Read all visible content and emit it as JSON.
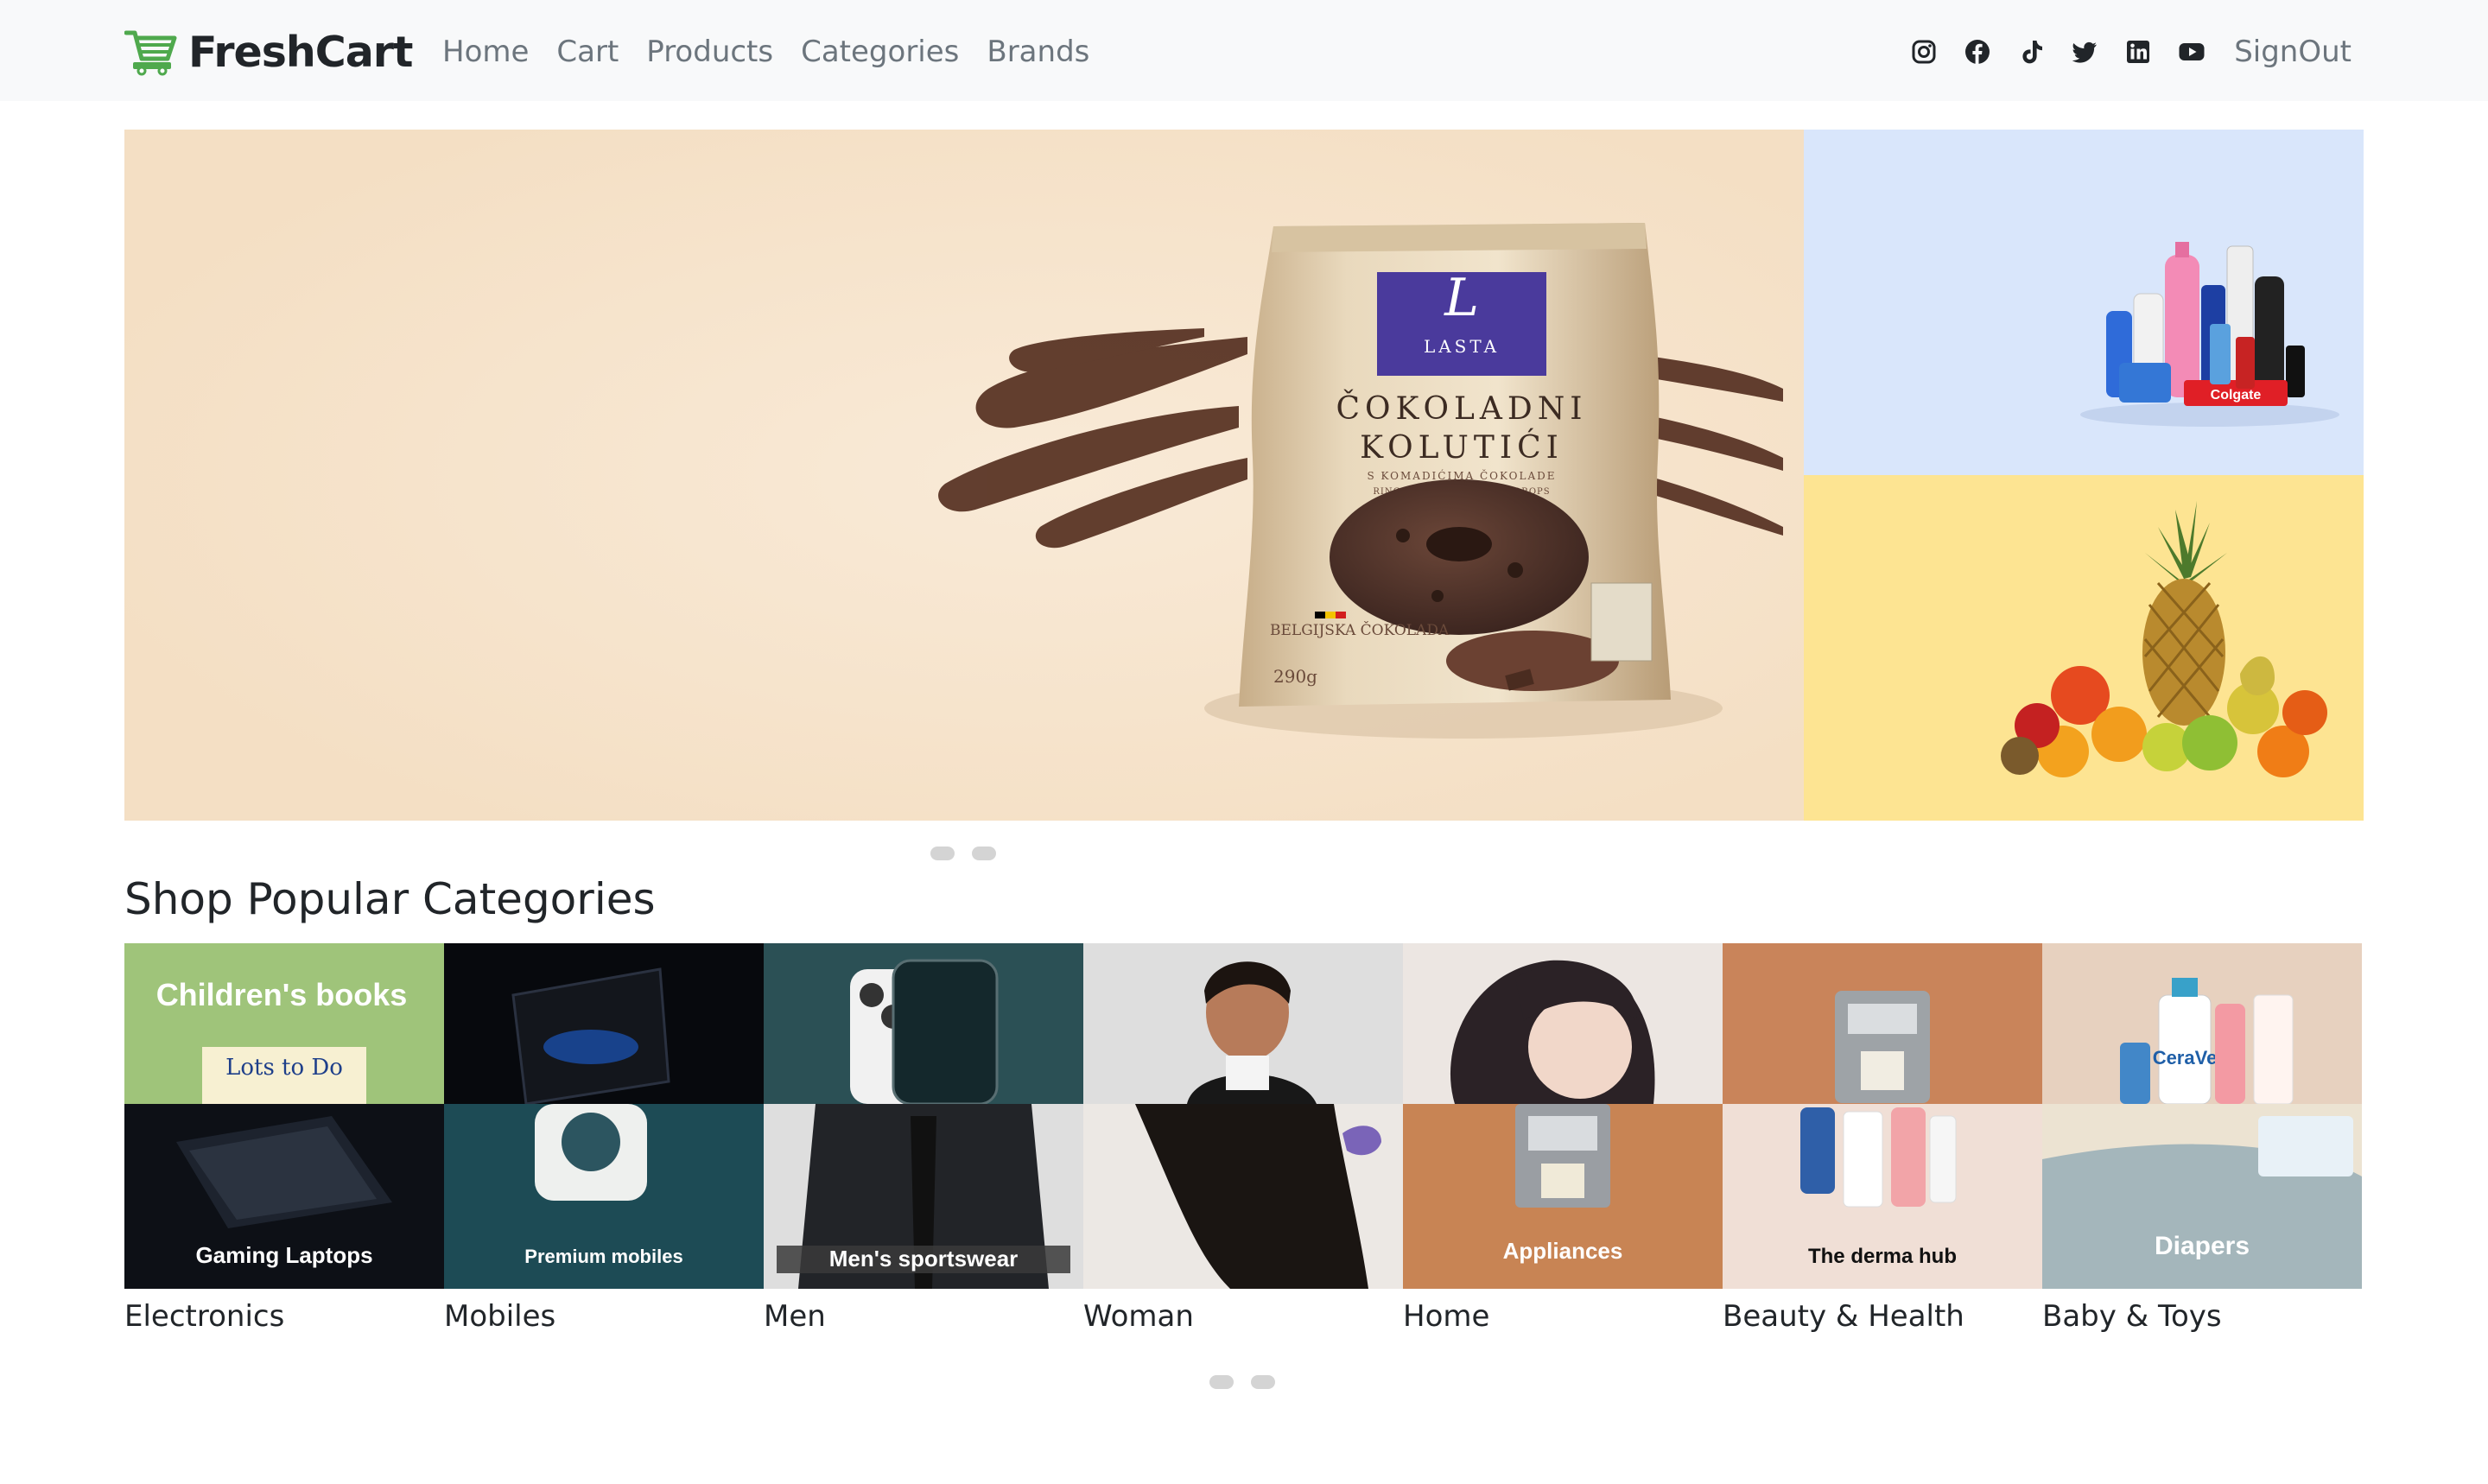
{
  "brand": {
    "name": "FreshCart",
    "accent": "#4fa94d"
  },
  "nav": {
    "links": [
      "Home",
      "Cart",
      "Products",
      "Categories",
      "Brands"
    ],
    "signout": "SignOut",
    "social_icons": [
      "instagram-icon",
      "facebook-icon",
      "tiktok-icon",
      "twitter-icon",
      "linkedin-icon",
      "youtube-icon"
    ]
  },
  "hero": {
    "product": {
      "brand_mark": "LASTA",
      "name_line1": "ČOKOLADNI",
      "name_line2": "KOLUTIĆI",
      "sub": "S KOMADIĆIMA ČOKOLADE",
      "sub2": "RINGS WITH CHOCOLATE DROPS",
      "origin": "BELGIJSKA ČOKOLADA",
      "weight": "290g"
    },
    "side_top_label": "Colgate",
    "colors": {
      "main_bg": "#f7e6d0",
      "side_top_bg": "#d9e6fb",
      "side_bottom_bg": "#fde492"
    }
  },
  "categories": {
    "title": "Shop Popular Categories",
    "items": [
      {
        "name": "Electronics",
        "top_label": "Children's books",
        "book_title": "Lots to Do",
        "bottom_label": "Gaming Laptops"
      },
      {
        "name": "Mobiles",
        "bottom_label": "Premium mobiles"
      },
      {
        "name": "Men",
        "bottom_label": "Men's sportswear"
      },
      {
        "name": "Woman"
      },
      {
        "name": "Home",
        "bottom_label": "Appliances"
      },
      {
        "name": "Beauty & Health",
        "bottom_label": "The derma hub"
      },
      {
        "name": "Baby & Toys",
        "bottom_label": "Diapers",
        "product_label": "CeraVe"
      }
    ]
  }
}
